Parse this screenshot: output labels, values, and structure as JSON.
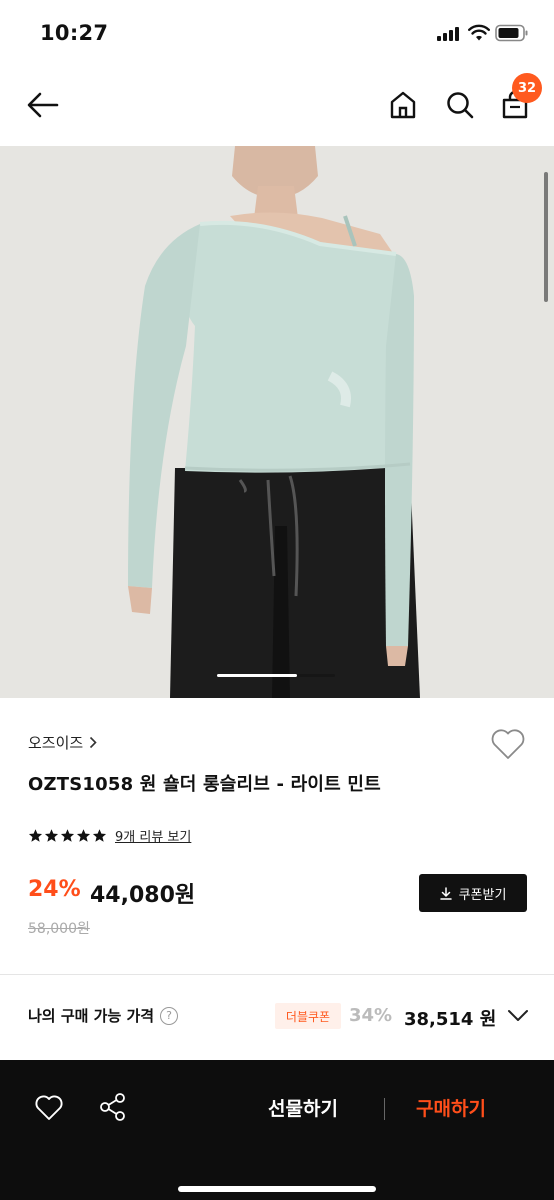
{
  "status_bar": {
    "time": "10:27"
  },
  "header": {
    "cart_count": "32",
    "icons": [
      "back-arrow-icon",
      "home-icon",
      "search-icon",
      "shopping-bag-icon"
    ]
  },
  "product": {
    "brand": "오즈이즈",
    "name": "OZTS1058 원 숄더 롱슬리브 - 라이트 민트",
    "rating": 5,
    "review_link": "9개 리뷰 보기",
    "discount_rate": "24%",
    "sale_price": "44,080원",
    "original_price": "58,000원",
    "coupon_button": "쿠폰받기",
    "image_colors": {
      "top": "#c7ddd6",
      "pants": "#1c1c1c",
      "background": "#e9e8e5"
    }
  },
  "my_price": {
    "label": "나의 구매 가능 가격",
    "badge": "더블쿠폰",
    "discount": "34%",
    "price": "38,514 원"
  },
  "bottom_bar": {
    "gift_label": "선물하기",
    "buy_label": "구매하기"
  },
  "colors": {
    "accent": "#ff4e1a",
    "dark": "#0d0d0d"
  }
}
